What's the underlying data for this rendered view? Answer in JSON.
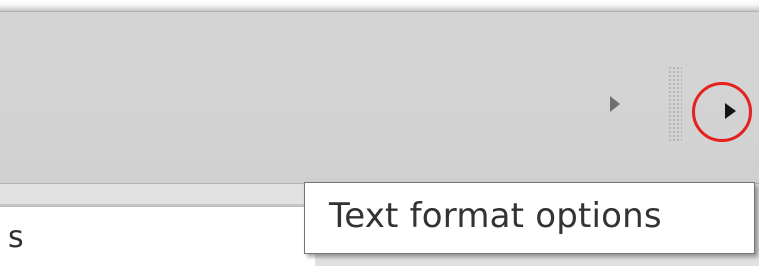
{
  "document": {
    "visible_text": "s"
  },
  "toolbar": {
    "left_arrow_icon": "chevron-right-icon",
    "right_arrow_icon": "chevron-right-icon",
    "highlight_color": "#e61f1f"
  },
  "tooltip": {
    "text": "Text format options"
  }
}
